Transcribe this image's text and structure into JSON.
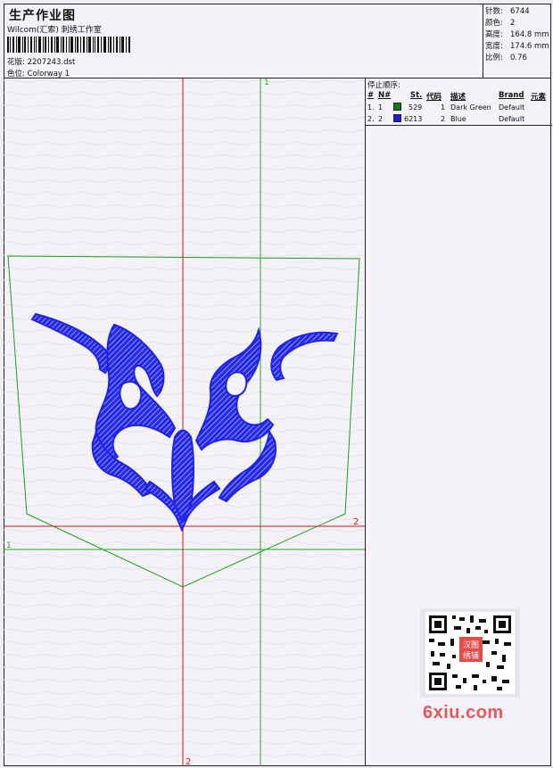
{
  "header": {
    "title": "生产作业图",
    "company": "Wilcom(汇索) 刺绣工作室",
    "design_label": "花版:",
    "design_value": "2207243.dst",
    "colorway_label": "色位:",
    "colorway_value": "Colorway 1"
  },
  "stats": {
    "stitches_label": "针数:",
    "stitches_value": "6744",
    "colors_label": "颜色:",
    "colors_value": "2",
    "height_label": "高度:",
    "height_value": "164.8 mm",
    "width_label": "宽度:",
    "width_value": "174.6 mm",
    "scale_label": "比例:",
    "scale_value": "0.76"
  },
  "stop_sequence": {
    "title": "停止顺序:",
    "columns": {
      "num": "#",
      "needle": "N#",
      "stitches": "St.",
      "code": "代码",
      "desc": "描述",
      "brand": "Brand",
      "element": "元素"
    },
    "rows": [
      {
        "num": "1.",
        "needle": "1",
        "stitches": "529",
        "code": "1",
        "desc": "Dark Green",
        "brand": "Default",
        "color": "#0a7a10"
      },
      {
        "num": "2.",
        "needle": "2",
        "stitches": "6213",
        "code": "2",
        "desc": "Blue",
        "brand": "Default",
        "color": "#1a1ae0"
      }
    ]
  },
  "axes": {
    "green_top": "1",
    "green_left": "1",
    "red_right": "2",
    "red_bottom": "2"
  },
  "watermark": "6xiu.com",
  "qr_stamp": "汉图绣铺",
  "colors": {
    "red_axis": "#e01010",
    "green_axis": "#20b020",
    "stitch_blue": "#1e22e6",
    "outline_green": "#1aa01a"
  }
}
